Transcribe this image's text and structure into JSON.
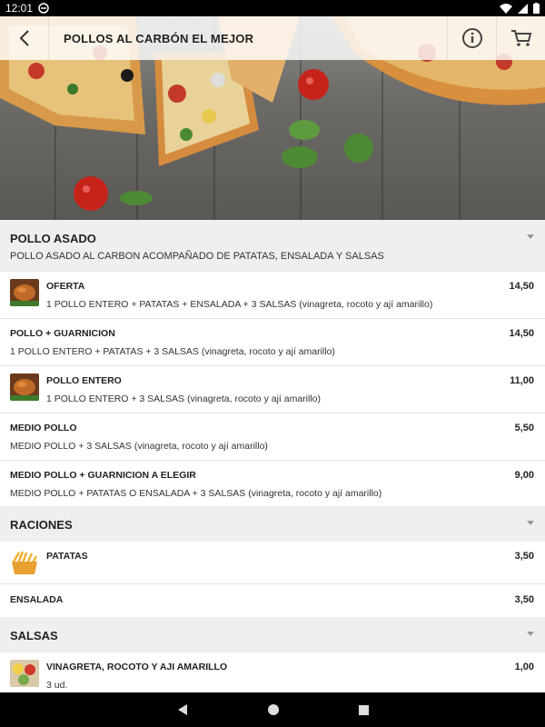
{
  "status_bar": {
    "time": "12:01"
  },
  "header": {
    "title": "POLLOS AL CARBÓN EL MEJOR"
  },
  "menu": [
    {
      "section": "POLLO ASADO",
      "description": "POLLO ASADO AL CARBON ACOMPAÑADO DE PATATAS, ENSALADA Y SALSAS",
      "items": [
        {
          "name": "OFERTA",
          "description": "1 POLLO ENTERO + PATATAS + ENSALADA + 3 SALSAS (vinagreta, rocoto y ají amarillo)",
          "price": "14,50",
          "image": "roast-chicken"
        },
        {
          "name": "POLLO + GUARNICION",
          "description": "1 POLLO ENTERO + PATATAS + 3 SALSAS (vinagreta, rocoto y ají amarillo)",
          "price": "14,50",
          "image": ""
        },
        {
          "name": "POLLO ENTERO",
          "description": "1 POLLO ENTERO + 3 SALSAS (vinagreta, rocoto y ají amarillo)",
          "price": "11,00",
          "image": "roast-chicken"
        },
        {
          "name": "MEDIO POLLO",
          "description": "MEDIO POLLO + 3 SALSAS (vinagreta, rocoto y ají amarillo)",
          "price": "5,50",
          "image": ""
        },
        {
          "name": "MEDIO POLLO + GUARNICION A ELEGIR",
          "description": "MEDIO POLLO + PATATAS O ENSALADA + 3 SALSAS (vinagreta, rocoto y ají amarillo)",
          "price": "9,00",
          "image": ""
        }
      ]
    },
    {
      "section": "RACIONES",
      "description": "",
      "items": [
        {
          "name": "PATATAS",
          "description": "",
          "price": "3,50",
          "image": "fries"
        },
        {
          "name": "ENSALADA",
          "description": "",
          "price": "3,50",
          "image": ""
        }
      ]
    },
    {
      "section": "SALSAS",
      "description": "",
      "items": [
        {
          "name": "VINAGRETA, ROCOTO Y AJI AMARILLO",
          "description": "3 ud.",
          "price": "1,00",
          "image": "sauces"
        }
      ]
    }
  ],
  "colors": {
    "section_bg": "#efefef",
    "divider": "#e2e2e2",
    "bar_black": "#000000"
  }
}
